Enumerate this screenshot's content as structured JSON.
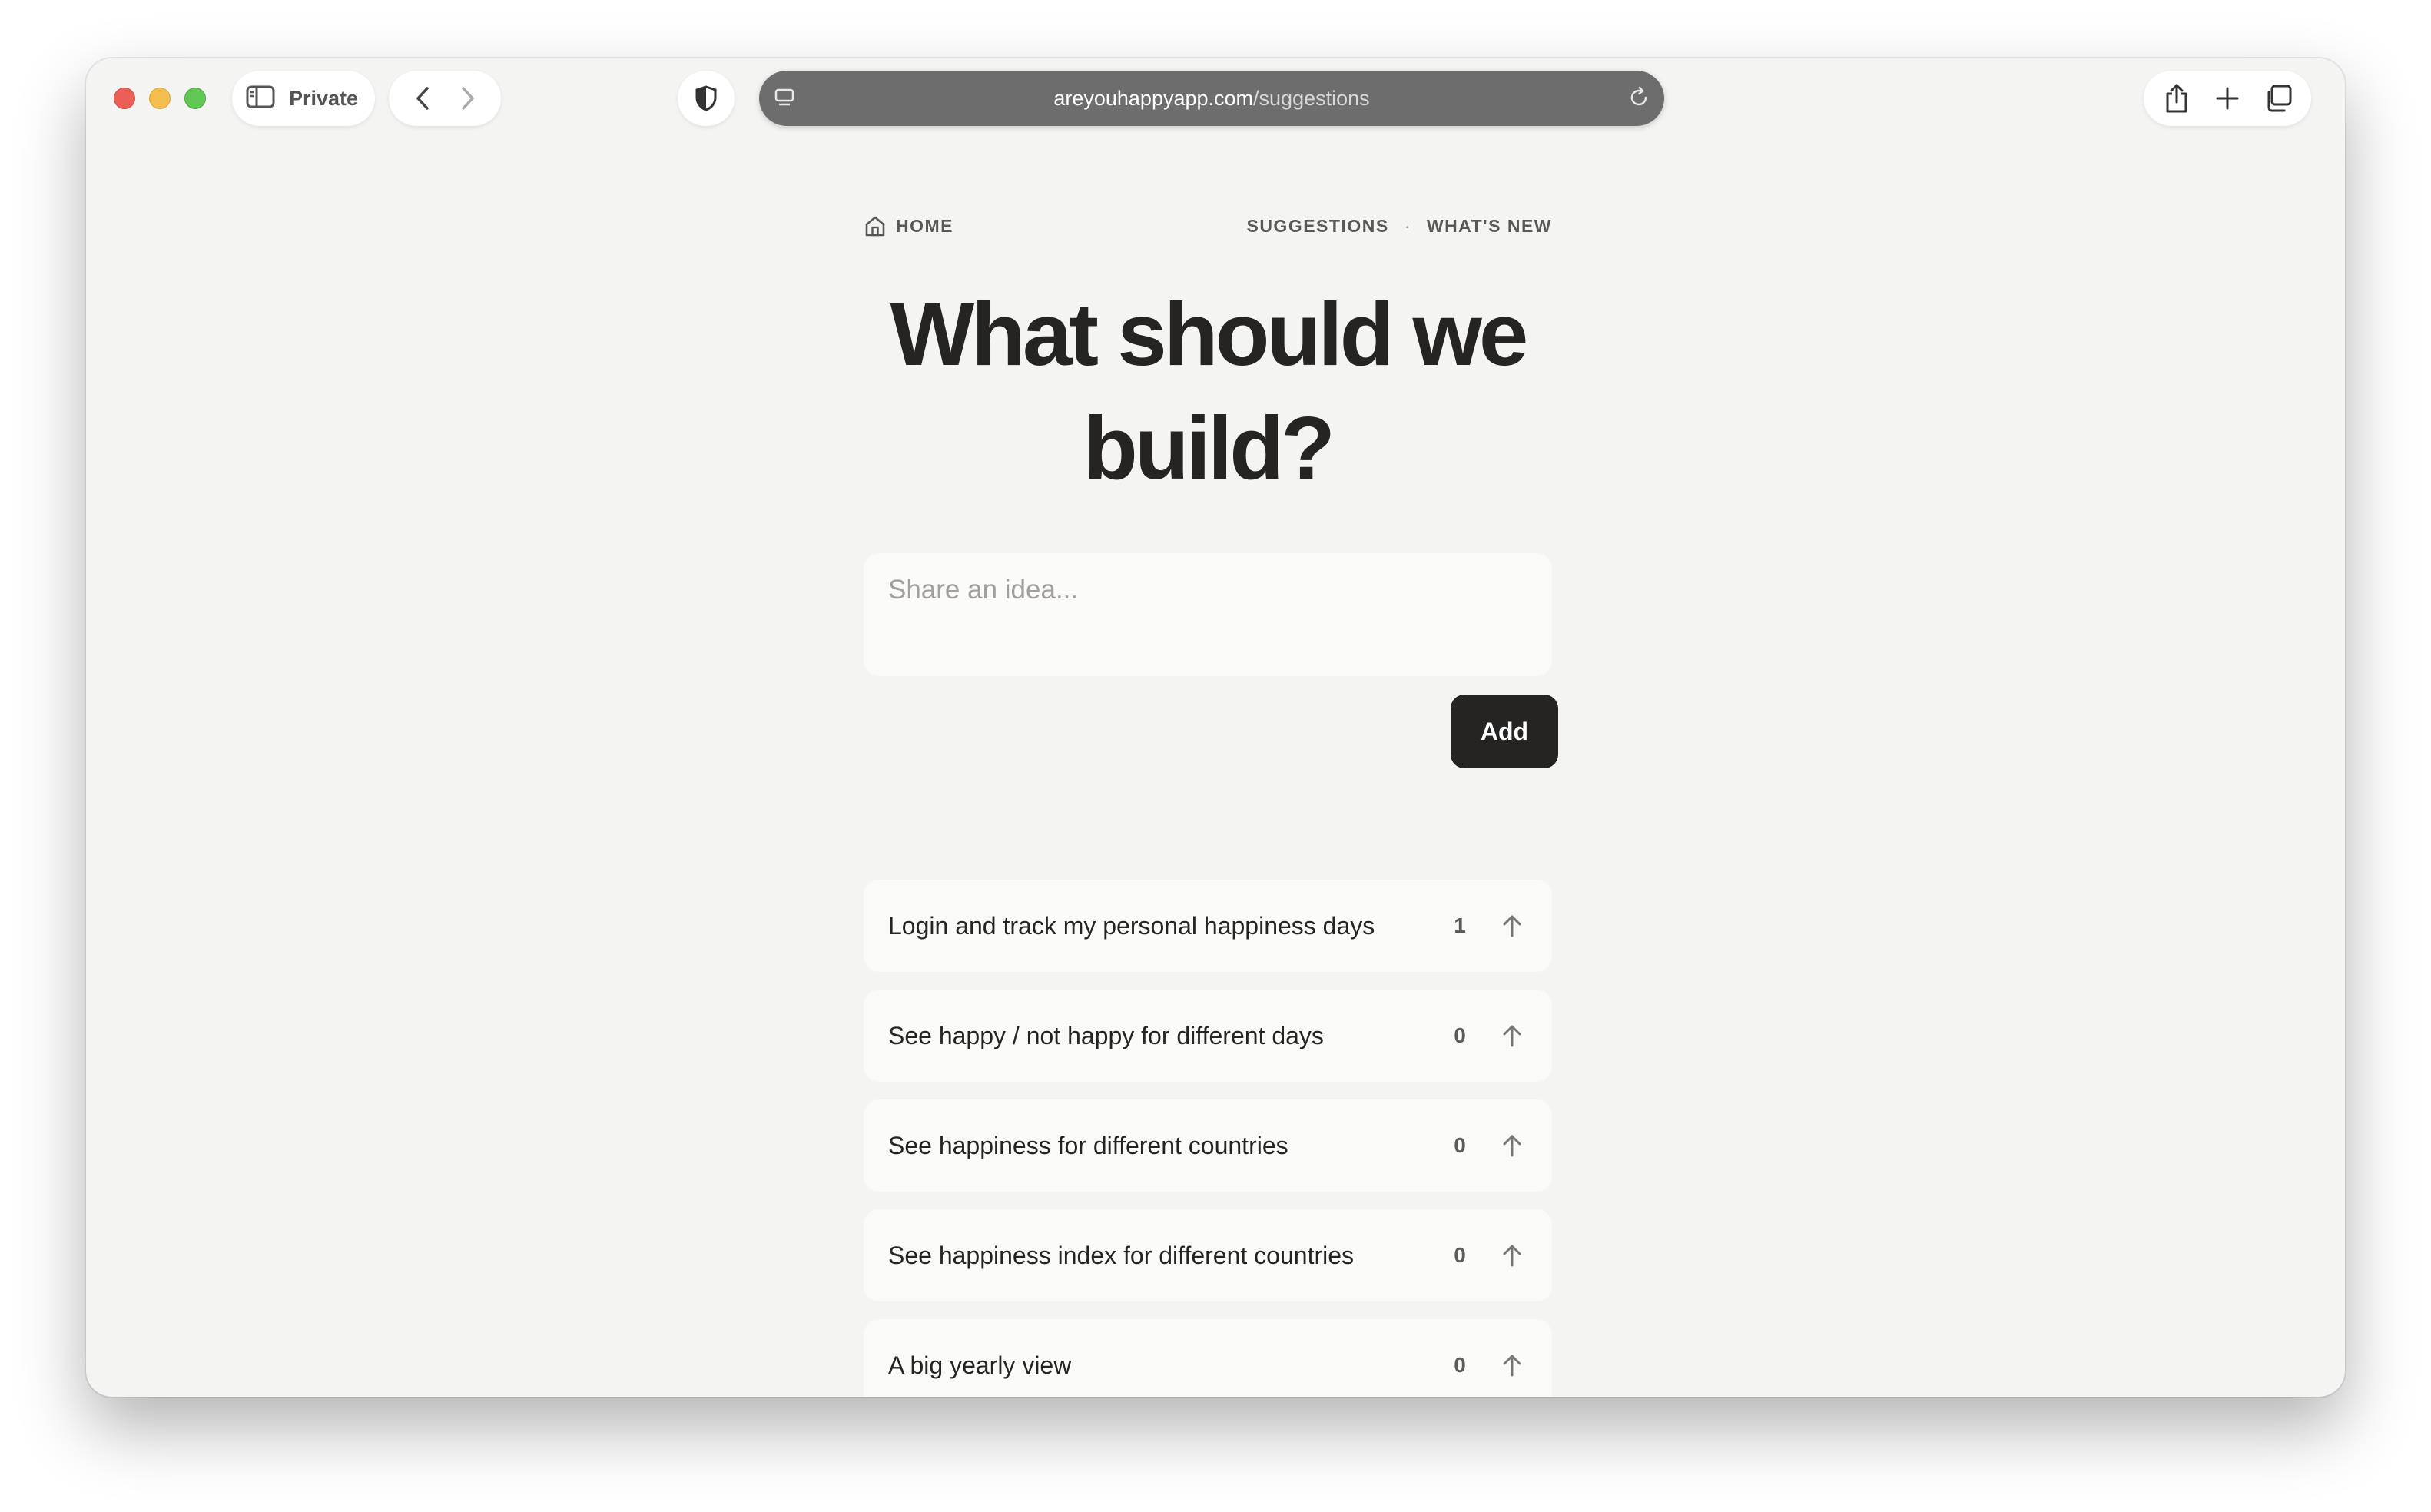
{
  "browser": {
    "private_label": "Private",
    "url_host": "areyouhappyapp.com",
    "url_path": "/suggestions"
  },
  "nav": {
    "home_label": "HOME",
    "suggestions_label": "SUGGESTIONS",
    "separator": "·",
    "whats_new_label": "WHAT'S NEW"
  },
  "page": {
    "headline_line1": "What should we",
    "headline_line2": "build?",
    "idea_placeholder": "Share an idea...",
    "add_label": "Add"
  },
  "suggestions": [
    {
      "text": "Login and track my personal happiness days",
      "votes": "1"
    },
    {
      "text": "See happy / not happy for different days",
      "votes": "0"
    },
    {
      "text": "See happiness for different countries",
      "votes": "0"
    },
    {
      "text": "See happiness index for different countries",
      "votes": "0"
    },
    {
      "text": "A big yearly view",
      "votes": "0"
    }
  ],
  "colors": {
    "page_background": "#f4f4f2",
    "card_background": "#fafaf9",
    "primary_dark": "#262422",
    "url_bar": "#6d6d6d"
  }
}
